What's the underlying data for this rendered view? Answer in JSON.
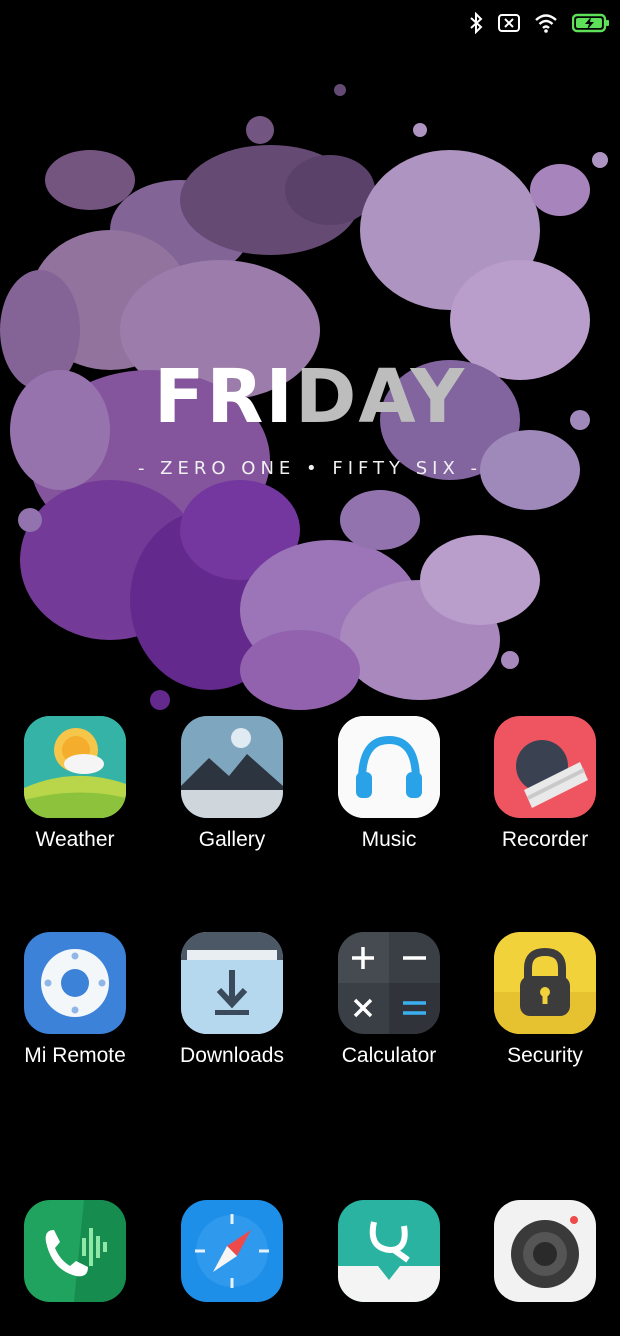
{
  "status_bar": {
    "icons": [
      "bluetooth-icon",
      "no-sim-icon",
      "wifi-icon",
      "battery-charging-icon"
    ]
  },
  "widget": {
    "day_part1": "FRI",
    "day_part2": "DAY",
    "time_words": "- ZERO ONE • FIFTY SIX -"
  },
  "apps": {
    "row1": [
      {
        "label": "Weather",
        "icon": "weather-icon"
      },
      {
        "label": "Gallery",
        "icon": "gallery-icon"
      },
      {
        "label": "Music",
        "icon": "music-icon"
      },
      {
        "label": "Recorder",
        "icon": "recorder-icon"
      }
    ],
    "row2": [
      {
        "label": "Mi Remote",
        "icon": "remote-icon"
      },
      {
        "label": "Downloads",
        "icon": "downloads-icon"
      },
      {
        "label": "Calculator",
        "icon": "calculator-icon"
      },
      {
        "label": "Security",
        "icon": "security-icon"
      }
    ],
    "dock": [
      {
        "icon": "phone-icon"
      },
      {
        "icon": "browser-icon"
      },
      {
        "icon": "quick-apps-icon"
      },
      {
        "icon": "camera-icon"
      }
    ]
  },
  "colors": {
    "background": "#000000",
    "splash_purple": "#9b6fb8",
    "splash_lavender": "#c3a6d6",
    "battery_green": "#5ee05a"
  }
}
